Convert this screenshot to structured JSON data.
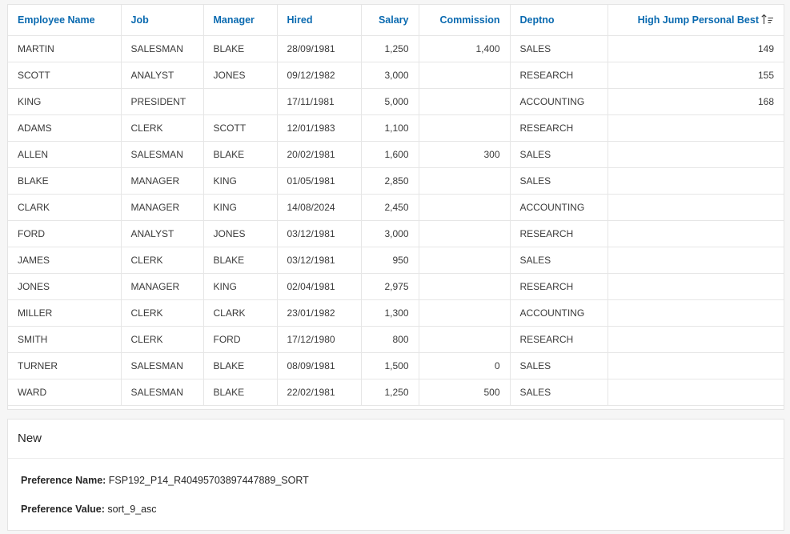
{
  "report": {
    "columns": [
      {
        "label": "Employee Name",
        "align": "left"
      },
      {
        "label": "Job",
        "align": "left"
      },
      {
        "label": "Manager",
        "align": "left"
      },
      {
        "label": "Hired",
        "align": "left"
      },
      {
        "label": "Salary",
        "align": "right"
      },
      {
        "label": "Commission",
        "align": "right"
      },
      {
        "label": "Deptno",
        "align": "left"
      },
      {
        "label": "High Jump Personal Best",
        "align": "right",
        "sort": "ascending",
        "sort_icon": "sort-ascending-icon"
      }
    ],
    "rows": [
      [
        "MARTIN",
        "SALESMAN",
        "BLAKE",
        "28/09/1981",
        "1,250",
        "1,400",
        "SALES",
        "149"
      ],
      [
        "SCOTT",
        "ANALYST",
        "JONES",
        "09/12/1982",
        "3,000",
        "",
        "RESEARCH",
        "155"
      ],
      [
        "KING",
        "PRESIDENT",
        "",
        "17/11/1981",
        "5,000",
        "",
        "ACCOUNTING",
        "168"
      ],
      [
        "ADAMS",
        "CLERK",
        "SCOTT",
        "12/01/1983",
        "1,100",
        "",
        "RESEARCH",
        ""
      ],
      [
        "ALLEN",
        "SALESMAN",
        "BLAKE",
        "20/02/1981",
        "1,600",
        "300",
        "SALES",
        ""
      ],
      [
        "BLAKE",
        "MANAGER",
        "KING",
        "01/05/1981",
        "2,850",
        "",
        "SALES",
        ""
      ],
      [
        "CLARK",
        "MANAGER",
        "KING",
        "14/08/2024",
        "2,450",
        "",
        "ACCOUNTING",
        ""
      ],
      [
        "FORD",
        "ANALYST",
        "JONES",
        "03/12/1981",
        "3,000",
        "",
        "RESEARCH",
        ""
      ],
      [
        "JAMES",
        "CLERK",
        "BLAKE",
        "03/12/1981",
        "950",
        "",
        "SALES",
        ""
      ],
      [
        "JONES",
        "MANAGER",
        "KING",
        "02/04/1981",
        "2,975",
        "",
        "RESEARCH",
        ""
      ],
      [
        "MILLER",
        "CLERK",
        "CLARK",
        "23/01/1982",
        "1,300",
        "",
        "ACCOUNTING",
        ""
      ],
      [
        "SMITH",
        "CLERK",
        "FORD",
        "17/12/1980",
        "800",
        "",
        "RESEARCH",
        ""
      ],
      [
        "TURNER",
        "SALESMAN",
        "BLAKE",
        "08/09/1981",
        "1,500",
        "0",
        "SALES",
        ""
      ],
      [
        "WARD",
        "SALESMAN",
        "BLAKE",
        "22/02/1981",
        "1,250",
        "500",
        "SALES",
        ""
      ]
    ]
  },
  "preferences": {
    "title": "New",
    "name_label": "Preference Name:",
    "name_value": "FSP192_P14_R40495703897447889_SORT",
    "value_label": "Preference Value:",
    "value_value": "sort_9_asc"
  },
  "colors": {
    "header_text": "#0a6ab0",
    "body_text": "#3a3a3a",
    "grid_line": "#e6e6e6",
    "page_bg": "#f6f6f6"
  }
}
